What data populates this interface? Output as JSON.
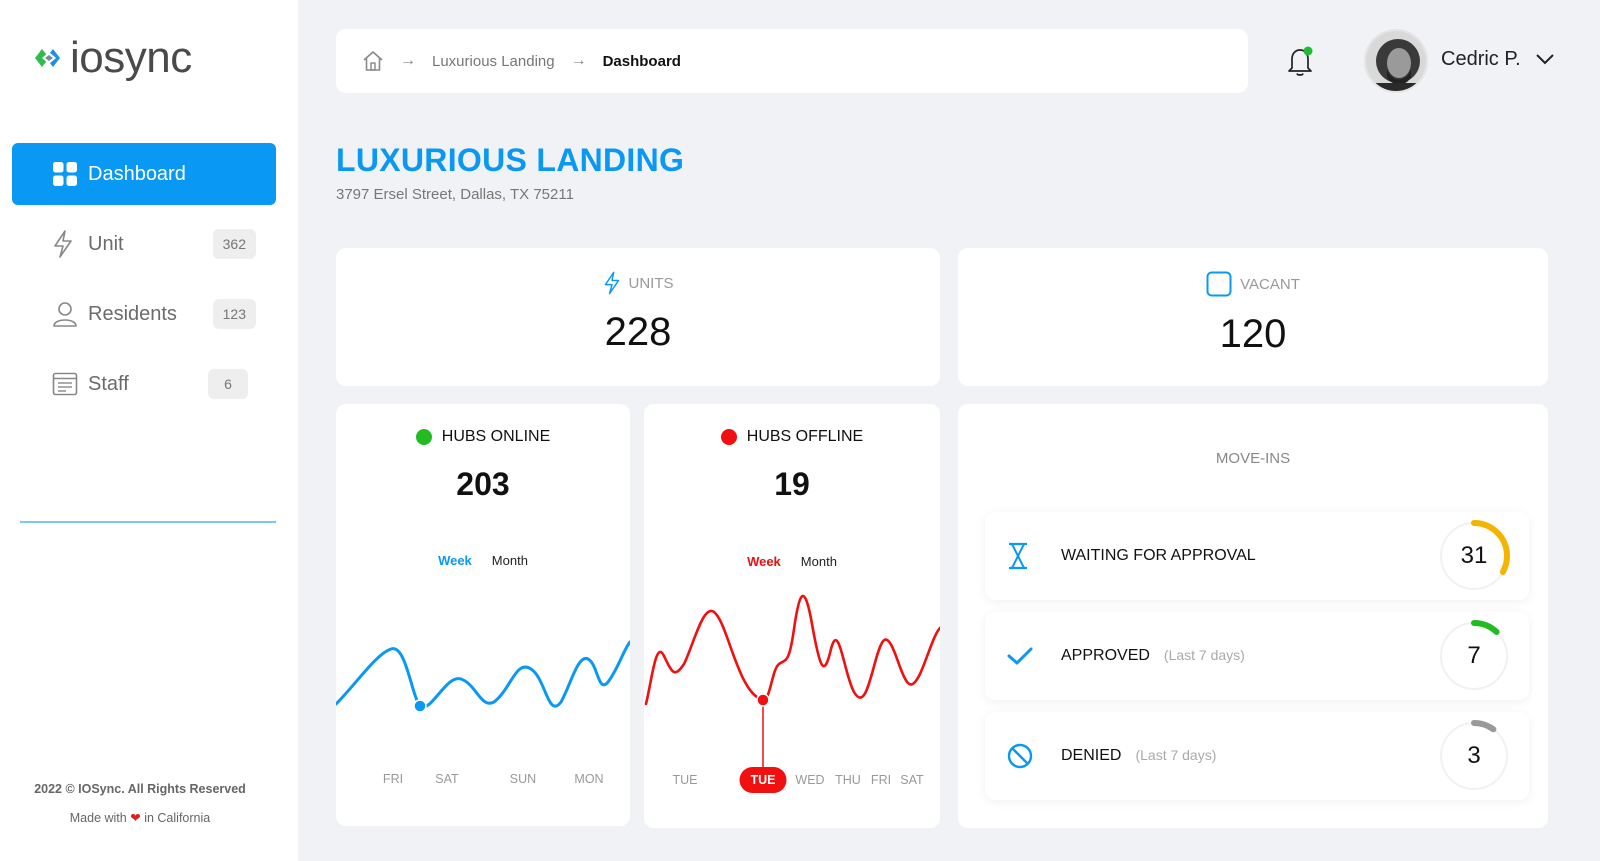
{
  "brand": {
    "logo_text": "iosync"
  },
  "sidebar": {
    "items": [
      {
        "label": "Dashboard",
        "badge": ""
      },
      {
        "label": "Unit",
        "badge": "362"
      },
      {
        "label": "Residents",
        "badge": "123"
      },
      {
        "label": "Staff",
        "badge": "6"
      }
    ],
    "footer_copyright": "2022 © IOSync. All Rights Reserved",
    "footer_made_prefix": "Made with",
    "footer_made_suffix": "in California"
  },
  "breadcrumb": {
    "items": [
      "Luxurious Landing",
      "Dashboard"
    ]
  },
  "user": {
    "name": "Cedric P."
  },
  "property": {
    "title": "LUXURIOUS LANDING",
    "address": "3797 Ersel Street, Dallas, TX 75211"
  },
  "stats": {
    "units": {
      "label": "UNITS",
      "value": "228"
    },
    "vacant": {
      "label": "VACANT",
      "value": "120"
    }
  },
  "hubs_online": {
    "label": "HUBS ONLINE",
    "value": "203",
    "tabs": [
      "Week",
      "Month"
    ],
    "x_labels": [
      "FRI",
      "SAT",
      "SUN",
      "MON"
    ],
    "color": "#0a98f5"
  },
  "hubs_offline": {
    "label": "HUBS OFFLINE",
    "value": "19",
    "tabs": [
      "Week",
      "Month"
    ],
    "x_labels": [
      "TUE",
      "TUE",
      "WED",
      "THU",
      "FRI",
      "SAT"
    ],
    "selected_label": "TUE",
    "color": "#f01010"
  },
  "move_ins": {
    "title": "MOVE-INS",
    "rows": [
      {
        "label": "WAITING FOR APPROVAL",
        "note": "",
        "value": "31",
        "fraction": 0.33,
        "color": "#f5b400",
        "icon": "hourglass-icon"
      },
      {
        "label": "APPROVED",
        "note": "(Last 7 days)",
        "value": "7",
        "fraction": 0.12,
        "color": "#22bb22",
        "icon": "check-icon"
      },
      {
        "label": "DENIED",
        "note": "(Last 7 days)",
        "value": "3",
        "fraction": 0.1,
        "color": "#999999",
        "icon": "ban-icon"
      }
    ]
  }
}
